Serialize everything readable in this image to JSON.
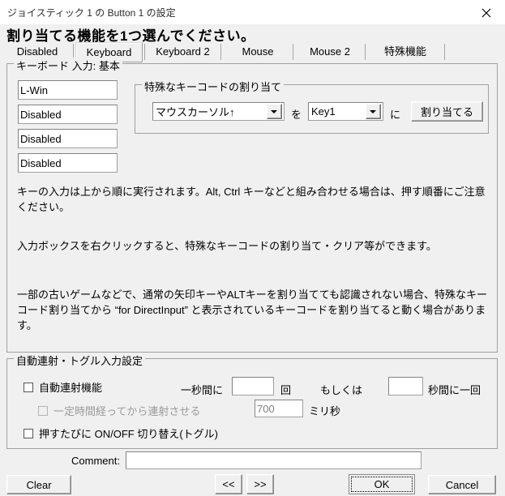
{
  "window": {
    "title": "ジョイスティック 1 の Button 1 の設定",
    "close_label": "close-icon"
  },
  "heading": "割り当てる機能を1つ選んでください。",
  "tabs": [
    {
      "label": "Disabled",
      "selected": false
    },
    {
      "label": "Keyboard",
      "selected": true
    },
    {
      "label": "Keyboard 2",
      "selected": false
    },
    {
      "label": "Mouse",
      "selected": false
    },
    {
      "label": "Mouse 2",
      "selected": false
    },
    {
      "label": "特殊機能",
      "selected": false
    }
  ],
  "keyboard_group": {
    "title": "キーボード 入力: 基本",
    "key_inputs": [
      {
        "value": "L-Win"
      },
      {
        "value": "Disabled"
      },
      {
        "value": "Disabled"
      },
      {
        "value": "Disabled"
      }
    ],
    "special_group": {
      "title": "特殊なキーコードの割り当て",
      "source_combo_value": "マウスカーソル↑",
      "particle_wo": "を",
      "target_combo_value": "Key1",
      "particle_ni": "に",
      "assign_button": "割り当てる"
    },
    "notes": [
      "キーの入力は上から順に実行されます。Alt, Ctrl キーなどと組み合わせる場合は、押す順番にご注意ください。",
      "入力ボックスを右クリックすると、特殊なキーコードの割り当て・クリア等ができます。",
      "一部の古いゲームなどで、通常の矢印キーやALTキーを割り当てても認識されない場合、特殊なキーコード割り当てから “for DirectInput” と表示されているキーコードを割り当てると動く場合があります。"
    ]
  },
  "autorepeat_group": {
    "title": "自動連射・トグル入力設定",
    "enable_checkbox": {
      "label": "自動連射機能",
      "checked": false,
      "enabled": true
    },
    "per_second_prefix": "一秒間に",
    "per_second_value": "",
    "per_second_suffix": "回",
    "or_label": "もしくは",
    "seconds_value": "",
    "seconds_suffix": "秒間に一回",
    "delay_checkbox": {
      "label": "一定時間経ってから連射させる",
      "checked": false,
      "enabled": false
    },
    "delay_value": "700",
    "delay_unit": "ミリ秒",
    "toggle_checkbox": {
      "label": "押すたびに ON/OFF 切り替え(トグル)",
      "checked": false,
      "enabled": true
    }
  },
  "footer": {
    "comment_label": "Comment:",
    "comment_value": "",
    "comment_placeholder": "",
    "clear_button": "Clear",
    "prev_button": "<<",
    "next_button": ">>",
    "ok_button": "OK",
    "cancel_button": "Cancel"
  }
}
